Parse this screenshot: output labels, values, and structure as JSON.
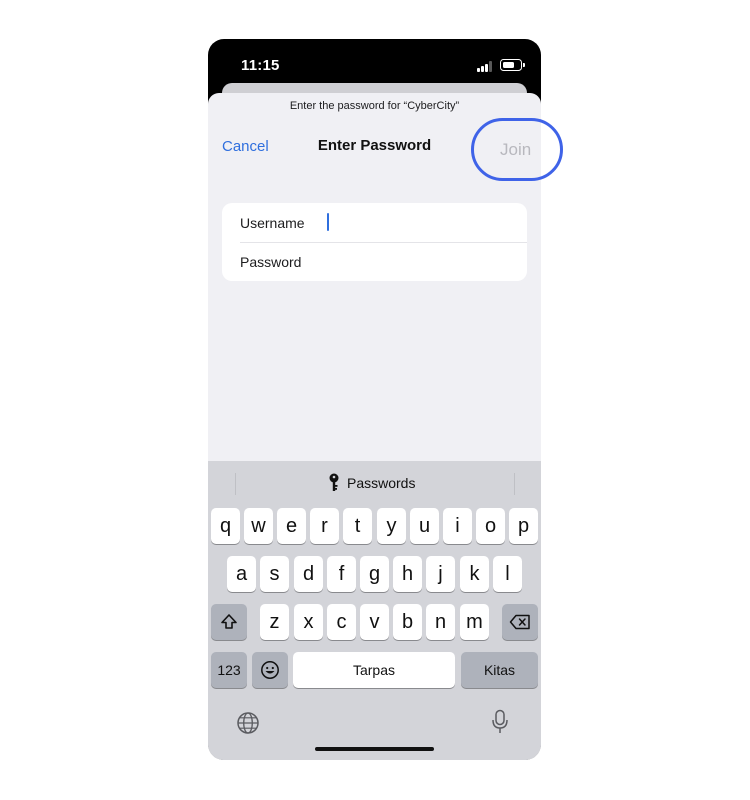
{
  "status_bar": {
    "time": "11:15"
  },
  "sheet": {
    "prompt": "Enter the password for “CyberCity”",
    "cancel_label": "Cancel",
    "title": "Enter Password",
    "join_label": "Join"
  },
  "form": {
    "username_label": "Username",
    "username_value": "",
    "password_label": "Password",
    "password_value": ""
  },
  "keyboard": {
    "suggestion": "Passwords",
    "row1": [
      "q",
      "w",
      "e",
      "r",
      "t",
      "y",
      "u",
      "i",
      "o",
      "p"
    ],
    "row2": [
      "a",
      "s",
      "d",
      "f",
      "g",
      "h",
      "j",
      "k",
      "l"
    ],
    "row3": [
      "z",
      "x",
      "c",
      "v",
      "b",
      "n",
      "m"
    ],
    "numbers_label": "123",
    "space_label": "Tarpas",
    "return_label": "Kitas"
  },
  "icons": {
    "signal": "signal-icon",
    "battery": "battery-icon",
    "key": "key-icon",
    "shift": "shift-icon",
    "delete": "delete-icon",
    "emoji": "emoji-icon",
    "globe": "globe-icon",
    "microphone": "microphone-icon"
  },
  "colors": {
    "accent": "#2f6fde",
    "highlight": "#3f63e8",
    "disabled": "#b8b8be"
  }
}
